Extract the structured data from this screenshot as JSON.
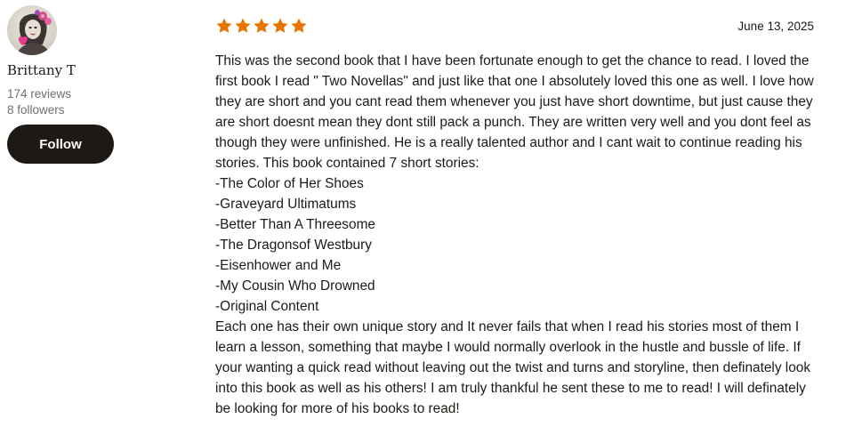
{
  "reviewer": {
    "name": "Brittany T",
    "reviews": "174 reviews",
    "followers": "8 followers",
    "follow_label": "Follow",
    "avatar_icon": "user-avatar-icon"
  },
  "review": {
    "rating": 5,
    "rating_max": 5,
    "star_color": "#e87400",
    "date": "June 13, 2025",
    "text": "This was the second book that I have been fortunate enough to get the chance to read. I loved the first book I read \" Two Novellas\" and just like that one I absolutely loved this one as well. I love how they are short and you cant read them whenever you just have short downtime, but just cause they are short doesnt mean they dont still pack a punch. They are written very well and you dont feel as though they were unfinished. He is a really talented author and I cant wait to continue reading his stories. This book contained 7 short stories:\n-The Color of Her Shoes\n-Graveyard Ultimatums\n-Better Than A Threesome\n-The Dragonsof Westbury\n-Eisenhower and Me\n-My Cousin Who Drowned\n-Original Content\nEach one has their own unique story and It never fails that when I read his stories most of them I learn a lesson, something that maybe I would normally overlook in the hustle and bussle of life. If your wanting a quick read without leaving out the twist and turns and storyline, then definately look into this book as well as his others! I am truly thankful he sent these to me to read! I will definately be looking for more of his books to read!"
  },
  "colors": {
    "text": "#1e1915",
    "muted": "#707070",
    "button_bg": "#1e1915",
    "button_text": "#ffffff"
  }
}
